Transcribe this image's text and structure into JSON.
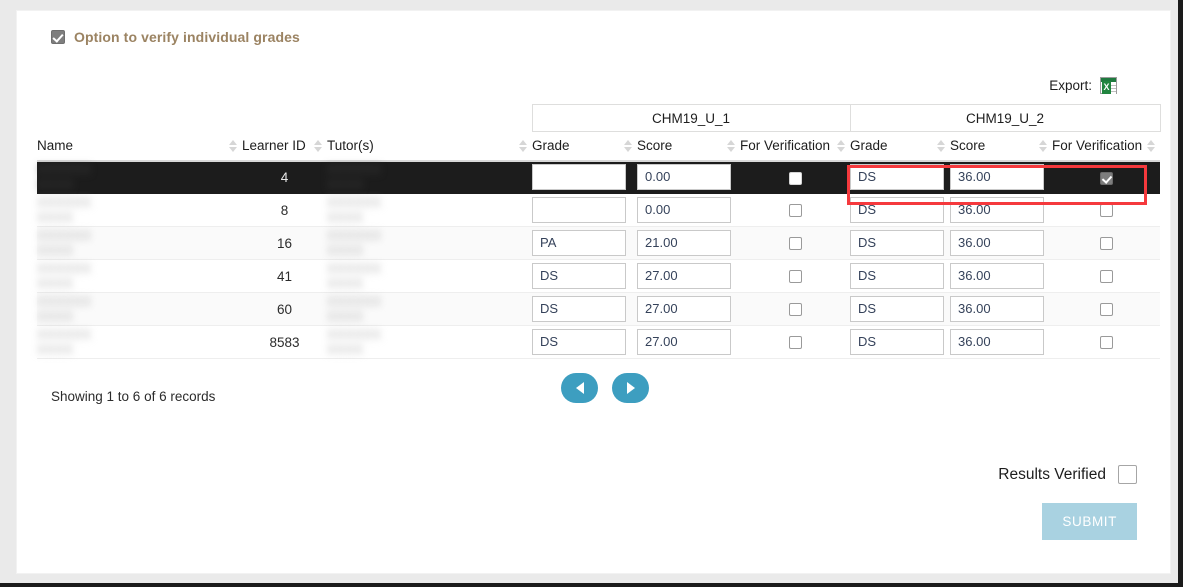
{
  "option": {
    "checkbox_checked": true,
    "label": "Option to verify individual grades",
    "label_color": "#9b8362"
  },
  "export": {
    "label": "Export:",
    "icon": "excel-icon"
  },
  "table": {
    "group_headers": [
      "",
      "",
      "",
      "CHM19_U_1",
      "CHM19_U_2"
    ],
    "unit_1": "CHM19_U_1",
    "unit_2": "CHM19_U_2",
    "columns": [
      "Name",
      "Learner ID",
      "Tutor(s)",
      "Grade",
      "Score",
      "For Verification",
      "Grade",
      "Score",
      "For Verification"
    ],
    "rows": [
      {
        "name": "",
        "learner_id": "4",
        "tutor": "",
        "u1_grade": "",
        "u1_score": "0.00",
        "u1_verify": false,
        "u2_grade": "DS",
        "u2_score": "36.00",
        "u2_verify": true,
        "selected": true
      },
      {
        "name": "",
        "learner_id": "8",
        "tutor": "",
        "u1_grade": "",
        "u1_score": "0.00",
        "u1_verify": false,
        "u2_grade": "DS",
        "u2_score": "36.00",
        "u2_verify": false,
        "selected": false
      },
      {
        "name": "",
        "learner_id": "16",
        "tutor": "",
        "u1_grade": "PA",
        "u1_score": "21.00",
        "u1_verify": false,
        "u2_grade": "DS",
        "u2_score": "36.00",
        "u2_verify": false,
        "selected": false
      },
      {
        "name": "",
        "learner_id": "41",
        "tutor": "",
        "u1_grade": "DS",
        "u1_score": "27.00",
        "u1_verify": false,
        "u2_grade": "DS",
        "u2_score": "36.00",
        "u2_verify": false,
        "selected": false
      },
      {
        "name": "",
        "learner_id": "60",
        "tutor": "",
        "u1_grade": "DS",
        "u1_score": "27.00",
        "u1_verify": false,
        "u2_grade": "DS",
        "u2_score": "36.00",
        "u2_verify": false,
        "selected": false
      },
      {
        "name": "",
        "learner_id": "8583",
        "tutor": "",
        "u1_grade": "DS",
        "u1_score": "27.00",
        "u1_verify": false,
        "u2_grade": "DS",
        "u2_score": "36.00",
        "u2_verify": false,
        "selected": false
      }
    ]
  },
  "footer": {
    "records_text": "Showing 1 to 6 of 6 records",
    "prev_icon": "chevron-left-icon",
    "next_icon": "chevron-right-icon",
    "pager_color": "#3d9ec0"
  },
  "verify": {
    "label": "Results Verified",
    "checked": false
  },
  "submit": {
    "label": "SUBMIT",
    "color": "#a9d2e1"
  },
  "highlight": {
    "color": "#f5393d",
    "target": "CHM19_U_2 cells of selected row"
  }
}
